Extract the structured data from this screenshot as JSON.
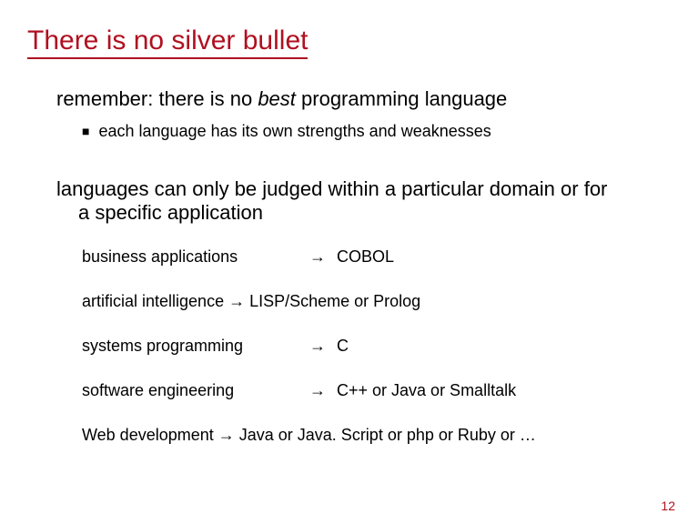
{
  "title": "There is no silver bullet",
  "line1_prefix": "remember: there is no ",
  "line1_best": "best",
  "line1_suffix": " programming language",
  "sub_bullet": "■",
  "sub1": "each language has its own strengths and weaknesses",
  "line2a": "languages can only be judged within a particular domain or for",
  "line2b": "a specific application",
  "arrow": "→",
  "examples": {
    "e1": {
      "left": "business applications",
      "right": "COBOL"
    },
    "e2_full": "artificial intelligence  →  LISP/Scheme or Prolog",
    "e3": {
      "left": "systems programming",
      "right": "C"
    },
    "e4": {
      "left": "software engineering",
      "right": "C++ or Java or Smalltalk"
    },
    "e5_full": "Web development   →  Java or Java. Script or php or Ruby or …"
  },
  "page_number": "12"
}
